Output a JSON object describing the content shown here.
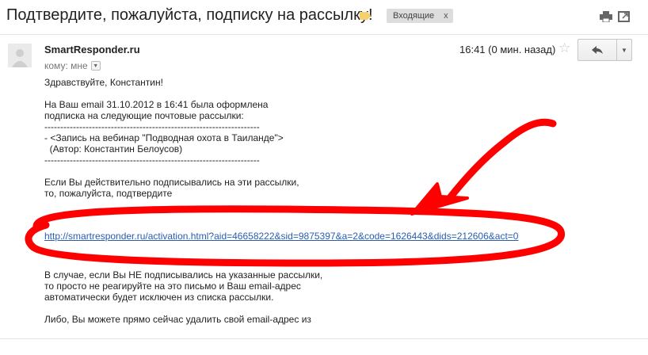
{
  "subject": "Подтвердите, пожалуйста, подписку на рассылку!",
  "label_chip": "Входящие",
  "label_chip_close": "x",
  "sender": "SmartResponder.ru",
  "to_line": "кому: мне",
  "time": "16:41 (0 мин. назад)",
  "body_lines_1": [
    "Здравствуйте, Константин!",
    "",
    "На Ваш email 31.10.2012 в 16:41 была оформлена",
    "подписка на следующие почтовые рассылки:",
    "--------------------------------------------------------------------",
    "- <Запись на вебинар \"Подводная охота в Таиланде\">",
    "  (Автор: Константин Белоусов)",
    "--------------------------------------------------------------------",
    "",
    "Если Вы действительно подписывались на эти рассылки,",
    "то, пожалуйста, подтвердите"
  ],
  "activation_link": "http://smartresponder.ru/activation.html?aid=46658222&sid=9875397&a=2&code=1626443&dids=212606&act=0",
  "body_lines_2": [
    "В случае, если Вы НЕ подписывались на указанные рассылки,",
    "то просто не реагируйте на это письмо и Ваш email-адрес",
    "автоматически будет исключен из списка рассылки.",
    "",
    "Либо, Вы можете прямо сейчас удалить свой email-адрес из"
  ],
  "icons": {
    "label": "label-tag-icon",
    "print": "print-icon",
    "new_window": "new-window-icon",
    "star": "star-icon",
    "reply": "reply-icon",
    "more": "chevron-down-icon"
  },
  "colors": {
    "annotation": "#ff0000",
    "link": "#2a5db0",
    "label_tag": "#f5d06b"
  }
}
